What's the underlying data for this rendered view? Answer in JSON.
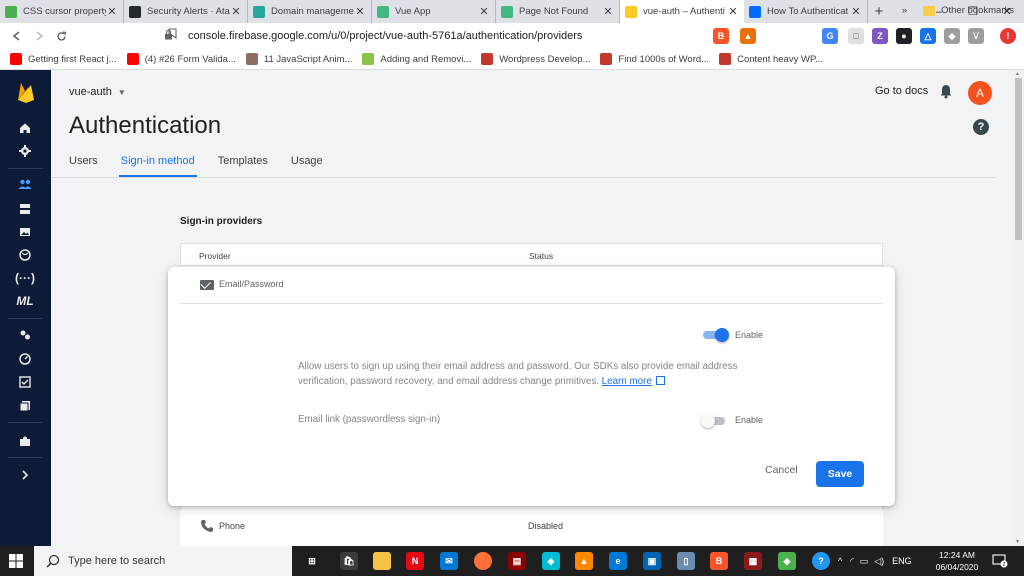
{
  "browser": {
    "tabs": [
      {
        "title": "CSS cursor property",
        "favicon": "w3schools-icon",
        "color": "#4caf50",
        "active": false
      },
      {
        "title": "Security Alerts · Atar",
        "favicon": "github-icon",
        "color": "#24292e",
        "active": false
      },
      {
        "title": "Domain managemen",
        "favicon": "diamond-icon",
        "color": "#26a69a",
        "active": false
      },
      {
        "title": "Vue App",
        "favicon": "vue-icon",
        "color": "#41b883",
        "active": false
      },
      {
        "title": "Page Not Found",
        "favicon": "vue-icon",
        "color": "#41b883",
        "active": false
      },
      {
        "title": "vue-auth – Authenti",
        "favicon": "firebase-icon",
        "color": "#ffca28",
        "active": true
      },
      {
        "title": "How To Authenticat",
        "favicon": "digitalocean-icon",
        "color": "#0069ff",
        "active": false
      }
    ],
    "new_tab": "+",
    "window_controls": [
      "–",
      "❐",
      "✕"
    ],
    "url": "console.firebase.google.com/u/0/project/vue-auth-5761a/authentication/providers",
    "bookmarks": [
      {
        "label": "Getting first React j...",
        "color": "#ff0000",
        "icon": "youtube-icon"
      },
      {
        "label": "(4) #26 Form Valida...",
        "color": "#ff0000",
        "icon": "youtube-icon"
      },
      {
        "label": "11 JavaScript Anim...",
        "color": "#8d6e63",
        "icon": "avatar-icon"
      },
      {
        "label": "Adding and Removi...",
        "color": "#8bc34a",
        "icon": "leaf-icon"
      },
      {
        "label": "Wordpress Develop...",
        "color": "#c0392b",
        "icon": "wordpress-icon"
      },
      {
        "label": "Find 1000s of Word...",
        "color": "#c0392b",
        "icon": "wordpress-icon"
      },
      {
        "label": "Content heavy WP...",
        "color": "#c0392b",
        "icon": "wordpress-icon"
      }
    ],
    "bookmarks_more": "»",
    "other_bookmarks": "Other bookmarks"
  },
  "console": {
    "project_name": "vue-auth",
    "go_to_docs": "Go to docs",
    "avatar_letter": "A",
    "page_title": "Authentication",
    "tabs": [
      "Users",
      "Sign-in method",
      "Templates",
      "Usage"
    ],
    "active_tab": "Sign-in method",
    "section_title": "Sign-in providers",
    "table_headers": {
      "provider": "Provider",
      "status": "Status"
    },
    "expanded_provider": {
      "name": "Email/Password",
      "enable_label": "Enable",
      "enabled": true,
      "description": "Allow users to sign up using their email address and password. Our SDKs also provide email address verification, password recovery, and email address change primitives.",
      "learn_more": "Learn more",
      "email_link_label": "Email link (passwordless sign-in)",
      "email_link_enable_label": "Enable",
      "email_link_enabled": false,
      "cancel": "Cancel",
      "save": "Save"
    },
    "rows": [
      {
        "provider": "Phone",
        "status": "Disabled"
      }
    ],
    "accent": "#1a73e8"
  },
  "taskbar": {
    "search_placeholder": "Type here to search",
    "language": "ENG",
    "time": "12:24 AM",
    "date": "06/04/2020",
    "notification_count": "2"
  }
}
